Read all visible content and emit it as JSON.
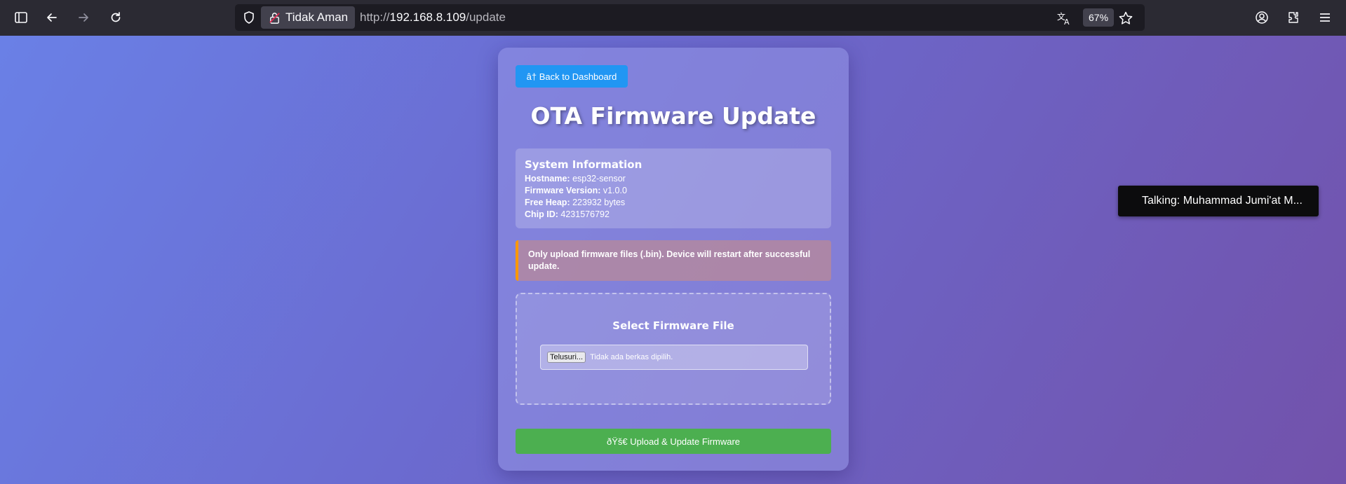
{
  "browser": {
    "security_label": "Tidak Aman",
    "url_prefix": "http://",
    "url_host": "192.168.8.109",
    "url_path": "/update",
    "zoom": "67%"
  },
  "page": {
    "back_label": "â† Back to Dashboard",
    "title": "OTA Firmware Update",
    "sysinfo": {
      "heading": "System Information",
      "rows": [
        {
          "label": "Hostname:",
          "value": "esp32-sensor"
        },
        {
          "label": "Firmware Version:",
          "value": "v1.0.0"
        },
        {
          "label": "Free Heap:",
          "value": "223932 bytes"
        },
        {
          "label": "Chip ID:",
          "value": "4231576792"
        }
      ]
    },
    "warning": "Only upload firmware files (.bin). Device will restart after successful update.",
    "upload": {
      "title": "Select Firmware File",
      "browse_label": "Telusuri...",
      "file_status": "Tidak ada berkas dipilih."
    },
    "submit_label": "ðŸš€ Upload & Update Firmware"
  },
  "overlay": {
    "talking": "Talking: Muhammad Jumi'at M..."
  },
  "colors": {
    "back_button": "#2196f3",
    "submit_button": "#4caf50",
    "warning_border": "#ff9800"
  }
}
